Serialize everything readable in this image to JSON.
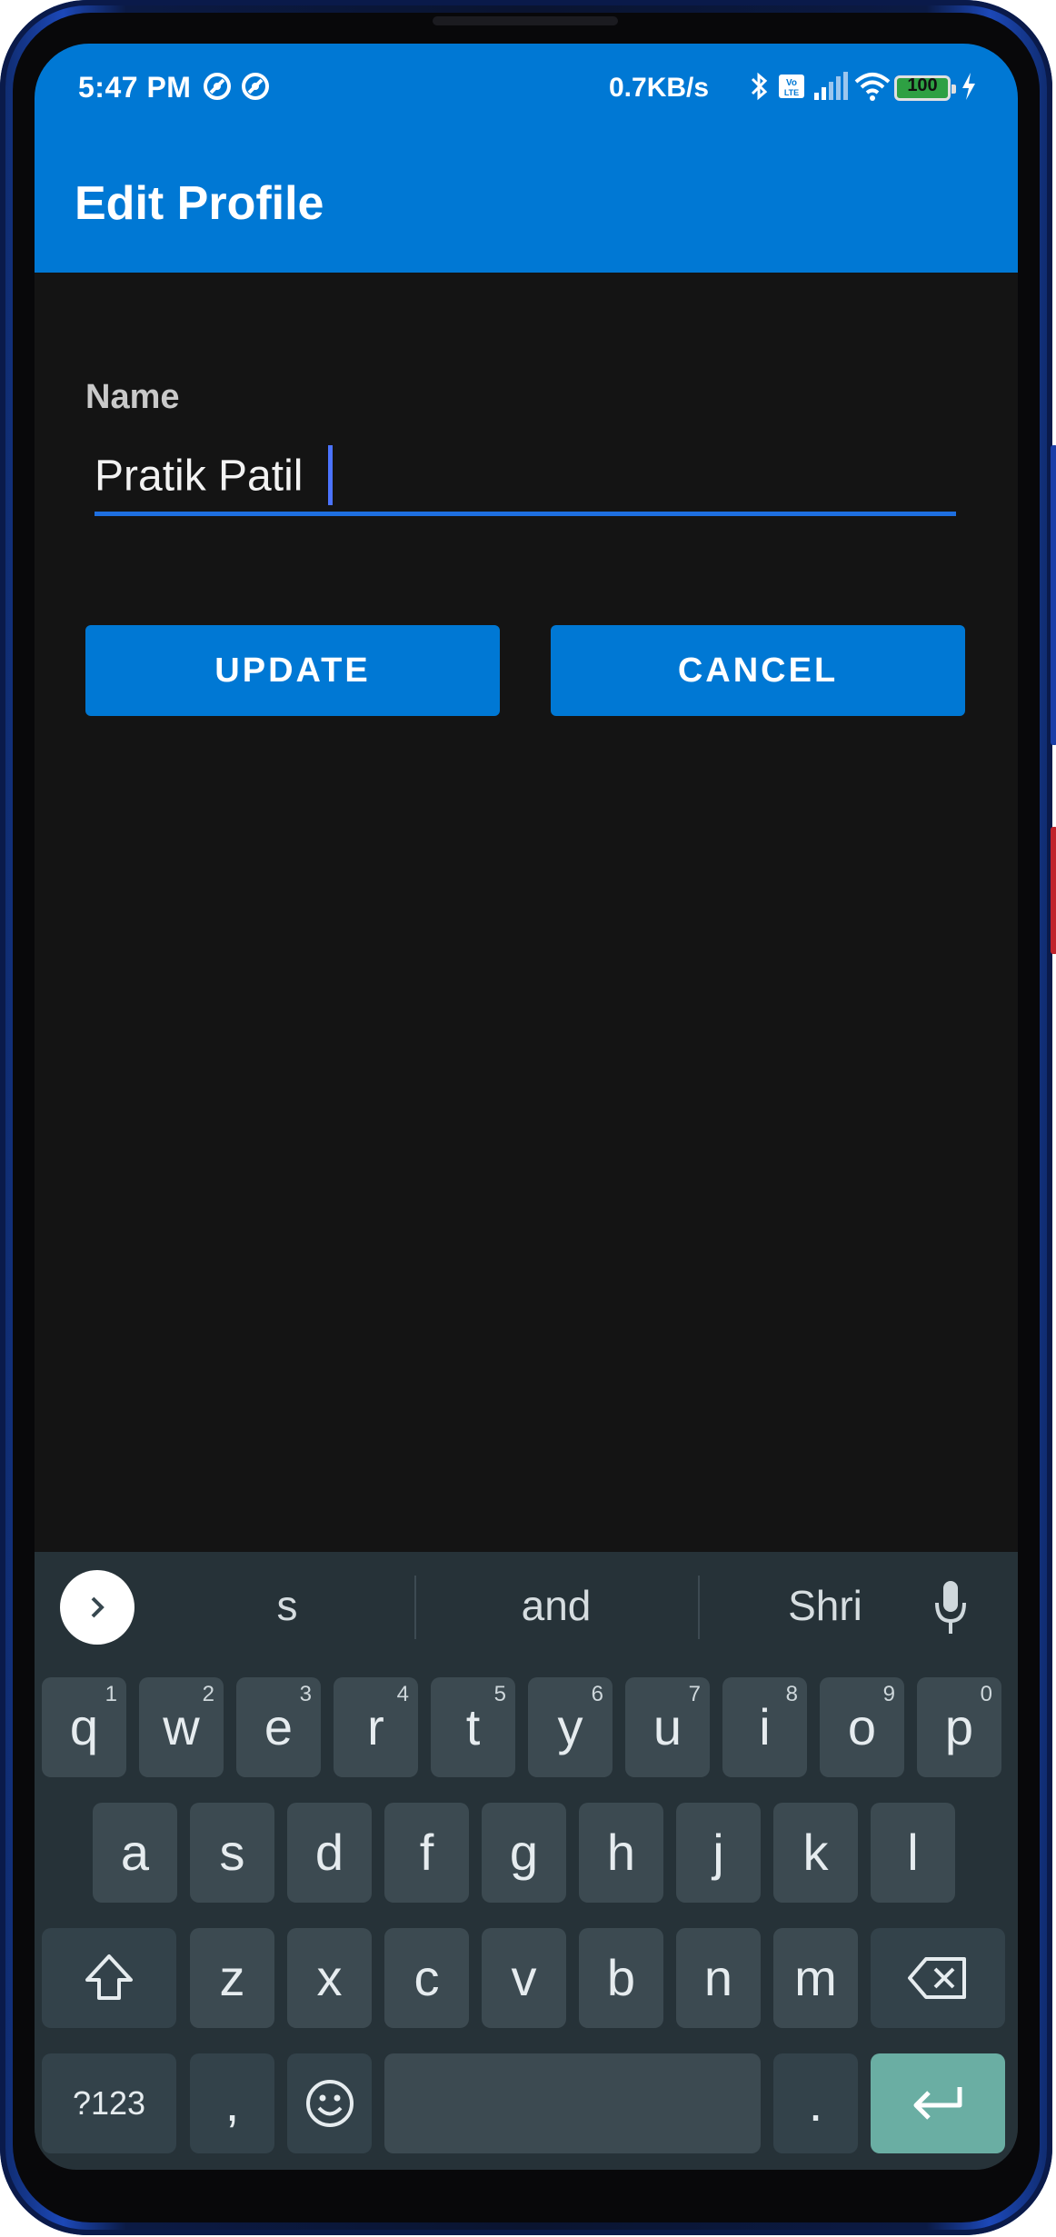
{
  "status_bar": {
    "time": "5:47 PM",
    "network_speed": "0.7KB/s",
    "battery_level": "100",
    "icons": [
      "app-notification-icon",
      "app-notification-icon",
      "bluetooth-icon",
      "volte-icon",
      "signal-icon",
      "wifi-icon",
      "battery-icon",
      "charging-icon"
    ]
  },
  "app_bar": {
    "title": "Edit Profile"
  },
  "form": {
    "name_label": "Name",
    "name_value": "Pratik Patil "
  },
  "buttons": {
    "update": "UPDATE",
    "cancel": "CANCEL"
  },
  "keyboard": {
    "suggestions": [
      "s",
      "and",
      "Shri"
    ],
    "row1": [
      {
        "k": "q",
        "n": "1"
      },
      {
        "k": "w",
        "n": "2"
      },
      {
        "k": "e",
        "n": "3"
      },
      {
        "k": "r",
        "n": "4"
      },
      {
        "k": "t",
        "n": "5"
      },
      {
        "k": "y",
        "n": "6"
      },
      {
        "k": "u",
        "n": "7"
      },
      {
        "k": "i",
        "n": "8"
      },
      {
        "k": "o",
        "n": "9"
      },
      {
        "k": "p",
        "n": "0"
      }
    ],
    "row2": [
      "a",
      "s",
      "d",
      "f",
      "g",
      "h",
      "j",
      "k",
      "l"
    ],
    "row3": [
      "z",
      "x",
      "c",
      "v",
      "b",
      "n",
      "m"
    ],
    "symbols_key": "?123",
    "comma_key": ",",
    "period_key": ".",
    "colors": {
      "background": "#263238",
      "key": "#3c4a51",
      "enter": "#6aaea3"
    }
  },
  "colors": {
    "accent": "#0078d4",
    "screen_bg": "#141414",
    "underline": "#1e6fe0"
  }
}
